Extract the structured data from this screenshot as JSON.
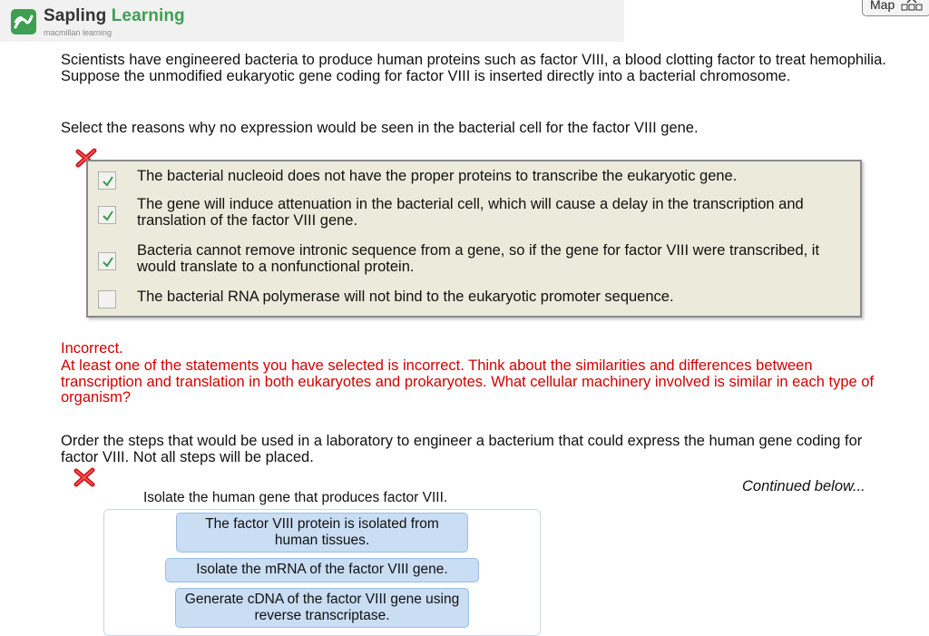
{
  "header": {
    "brand_part1": "Sapling",
    "brand_part2": "Learning",
    "sub": "macmillan learning",
    "map_label": "Map"
  },
  "question": {
    "intro": "Scientists have engineered bacteria to produce human proteins such as factor VIII, a blood clotting factor to treat hemophilia. Suppose the unmodified eukaryotic gene coding for factor VIII is inserted directly into a bacterial chromosome.",
    "prompt": "Select the reasons why no expression would be seen in the bacterial cell for the factor VIII gene.",
    "options": [
      {
        "text": "The bacterial nucleoid does not have the proper proteins to transcribe the eukaryotic gene.",
        "checked": true
      },
      {
        "text": "The gene will induce attenuation in the bacterial cell, which will cause a delay in the transcription and translation of the factor VIII gene.",
        "checked": true
      },
      {
        "text": "Bacteria cannot remove intronic sequence from a gene, so if the gene for factor VIII were transcribed, it would translate to a nonfunctional protein.",
        "checked": true
      },
      {
        "text": "The bacterial RNA polymerase will not bind to the eukaryotic promoter sequence.",
        "checked": false
      }
    ],
    "feedback_title": "Incorrect.",
    "feedback_body": "At least one of the statements you have selected is incorrect. Think about the similarities and differences between transcription and translation in both eukaryotes and prokaryotes. What cellular machinery involved is similar in each type of organism?"
  },
  "ordering": {
    "prompt": "Order the steps that would be used in a laboratory to engineer a bacterium that could express the human gene coding for factor VIII. Not all steps will be placed.",
    "continued": "Continued below...",
    "first_step": "Isolate the human gene that produces factor VIII.",
    "chips": [
      "The factor VIII protein is isolated from human tissues.",
      "Isolate the mRNA of the factor VIII gene.",
      "Generate cDNA of the factor VIII gene using reverse transcriptase."
    ]
  },
  "colors": {
    "brand_green": "#3f9e52",
    "incorrect_red": "#d20000",
    "answer_box_bg": "#eceadb",
    "chip_bg": "#c9ddf3",
    "check_green": "#3c9a4a"
  },
  "icons": [
    "sapling-logo-icon",
    "map-grid-icon",
    "incorrect-x-icon",
    "checkmark-icon"
  ]
}
